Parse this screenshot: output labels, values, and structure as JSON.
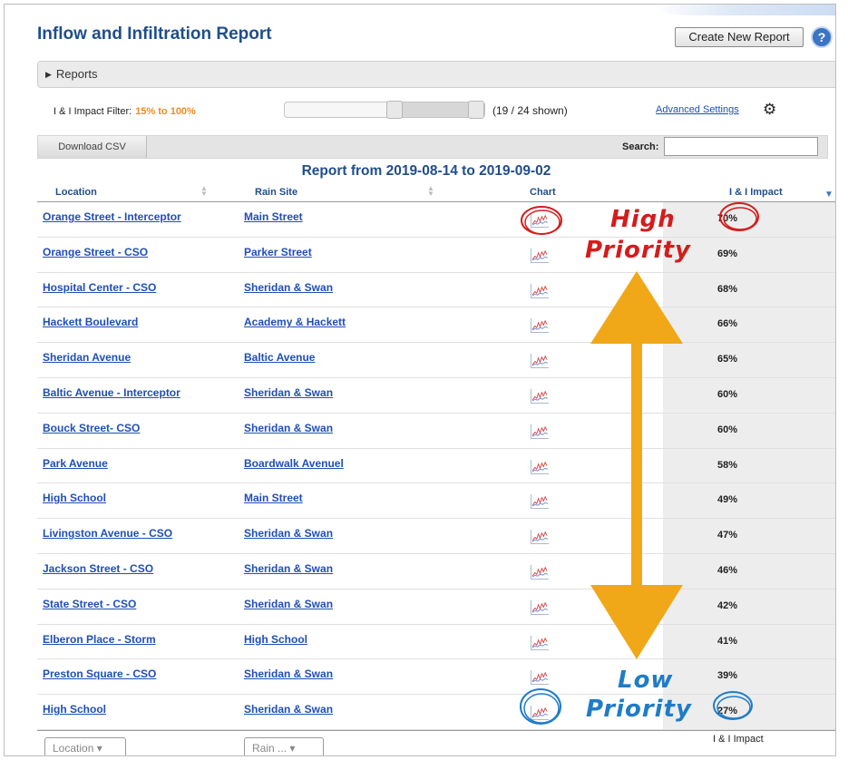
{
  "header": {
    "title": "Inflow and Infiltration Report",
    "create_button": "Create New Report",
    "help_icon": "?"
  },
  "reports_bar": {
    "label": "Reports"
  },
  "filter": {
    "label": "I & I Impact Filter:",
    "value": "15% to 100%",
    "range_min": 0.15,
    "range_max": 1.0,
    "shown": "(19 / 24  shown)",
    "advanced_settings": "Advanced Settings"
  },
  "toolbar": {
    "download_csv": "Download CSV",
    "search_label": "Search:",
    "search_value": ""
  },
  "report_range": "Report from 2019-08-14 to 2019-09-02",
  "table": {
    "columns": [
      "Location",
      "Rain Site",
      "Chart",
      "I & I Impact"
    ],
    "rows": [
      {
        "location": "Orange Street - Interceptor",
        "rain_site": "Main Street",
        "impact": "70%"
      },
      {
        "location": "Orange Street - CSO",
        "rain_site": "Parker Street",
        "impact": "69%"
      },
      {
        "location": "Hospital Center - CSO",
        "rain_site": "Sheridan & Swan",
        "impact": "68%"
      },
      {
        "location": "Hackett Boulevard",
        "rain_site": "Academy & Hackett",
        "impact": "66%"
      },
      {
        "location": "Sheridan Avenue",
        "rain_site": "Baltic Avenue",
        "impact": "65%"
      },
      {
        "location": "Baltic Avenue - Interceptor",
        "rain_site": "Sheridan & Swan",
        "impact": "60%"
      },
      {
        "location": "Bouck Street- CSO",
        "rain_site": "Sheridan & Swan",
        "impact": "60%"
      },
      {
        "location": "Park Avenue",
        "rain_site": "Boardwalk Avenuel",
        "impact": "58%"
      },
      {
        "location": "High School",
        "rain_site": "Main Street",
        "impact": "49%"
      },
      {
        "location": "Livingston Avenue - CSO",
        "rain_site": "Sheridan & Swan",
        "impact": "47%"
      },
      {
        "location": "Jackson Street - CSO",
        "rain_site": "Sheridan & Swan",
        "impact": "46%"
      },
      {
        "location": "State Street - CSO",
        "rain_site": "Sheridan & Swan",
        "impact": "42%"
      },
      {
        "location": "Elberon Place - Storm",
        "rain_site": "High School",
        "impact": "41%"
      },
      {
        "location": "Preston Square - CSO",
        "rain_site": "Sheridan & Swan",
        "impact": "39%"
      },
      {
        "location": "High School",
        "rain_site": "Sheridan & Swan",
        "impact": "27%"
      }
    ],
    "chart_icon": "sparkline-chart-icon"
  },
  "footer": {
    "location_select": "Location",
    "rain_select": "Rain ...",
    "impact_label": "I & I Impact"
  },
  "annotations": {
    "high_line1": "High",
    "high_line2": "Priority",
    "low_line1": "Low",
    "low_line2": "Priority",
    "colors": {
      "high": "#d41c1c",
      "low": "#1f7cc7",
      "arrow": "#f0a818"
    }
  },
  "colors": {
    "title": "#1f4e8c",
    "link": "#1f4fb5",
    "filter_value": "#f08a1e"
  }
}
